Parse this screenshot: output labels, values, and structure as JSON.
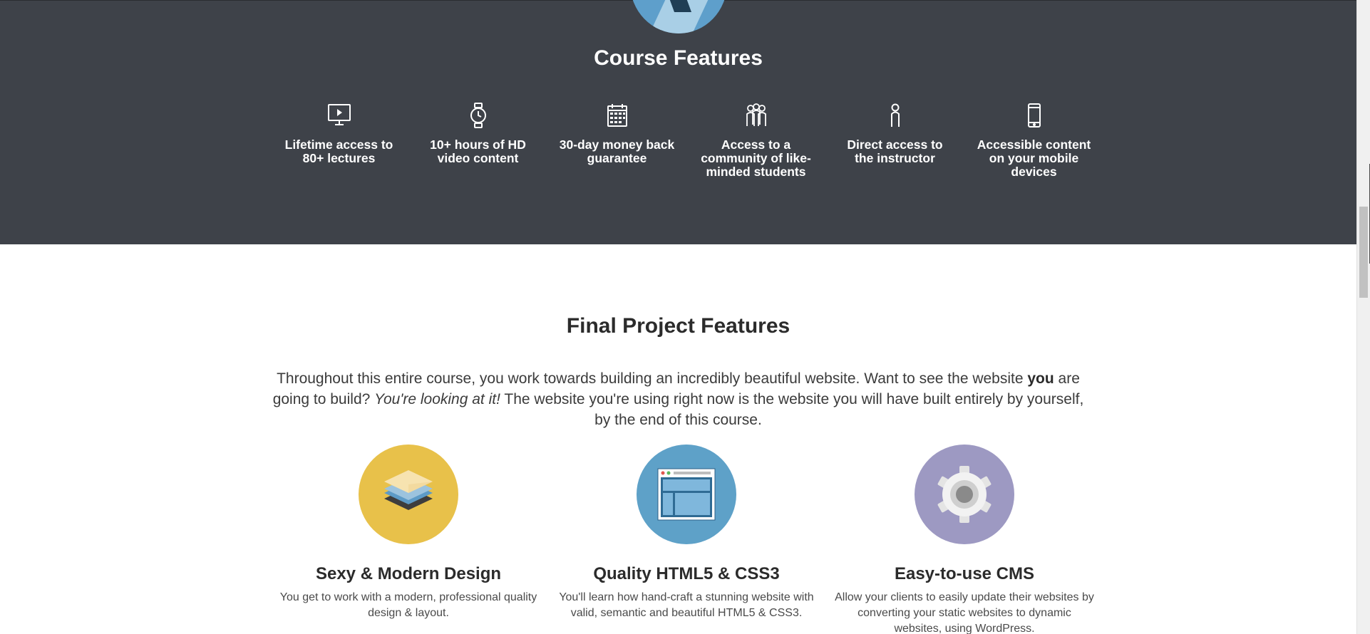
{
  "course_section": {
    "title": "Course Features",
    "features": [
      {
        "icon": "monitor-play-icon",
        "label": "Lifetime access to 80+ lectures"
      },
      {
        "icon": "stopwatch-icon",
        "label": "10+ hours of HD video content"
      },
      {
        "icon": "calendar-icon",
        "label": "30-day money back guarantee"
      },
      {
        "icon": "people-group-icon",
        "label": "Access to a community of like-minded students"
      },
      {
        "icon": "person-icon",
        "label": "Direct access to the instructor"
      },
      {
        "icon": "mobile-phone-icon",
        "label": "Accessible content on your mobile devices"
      }
    ]
  },
  "final_section": {
    "title": "Final Project Features",
    "intro_part1": "Throughout this entire course, you work towards building an incredibly beautiful website. Want to see the website ",
    "intro_bold": "you",
    "intro_part2": " are going to build? ",
    "intro_italic": "You're looking at it!",
    "intro_part3": " The website you're using right now is the website you will have built entirely by yourself, by the end of this course.",
    "projects": [
      {
        "icon": "layers-icon",
        "color": "#e8c14a",
        "title": "Sexy & Modern Design",
        "text": "You get to work with a modern, professional quality design & layout."
      },
      {
        "icon": "browser-window-icon",
        "color": "#5ea1c8",
        "title": "Quality HTML5 & CSS3",
        "text": "You'll learn how hand-craft a stunning website with valid, semantic and beautiful HTML5 & CSS3."
      },
      {
        "icon": "gear-icon",
        "color": "#9d99c2",
        "title": "Easy-to-use CMS",
        "text": "Allow your clients to easily update their websites by converting your static websites to dynamic websites, using WordPress."
      }
    ]
  },
  "colors": {
    "dark_band": "#3e4249",
    "yellow": "#e8c14a",
    "blue": "#5ea1c8",
    "purple": "#9d99c2"
  }
}
